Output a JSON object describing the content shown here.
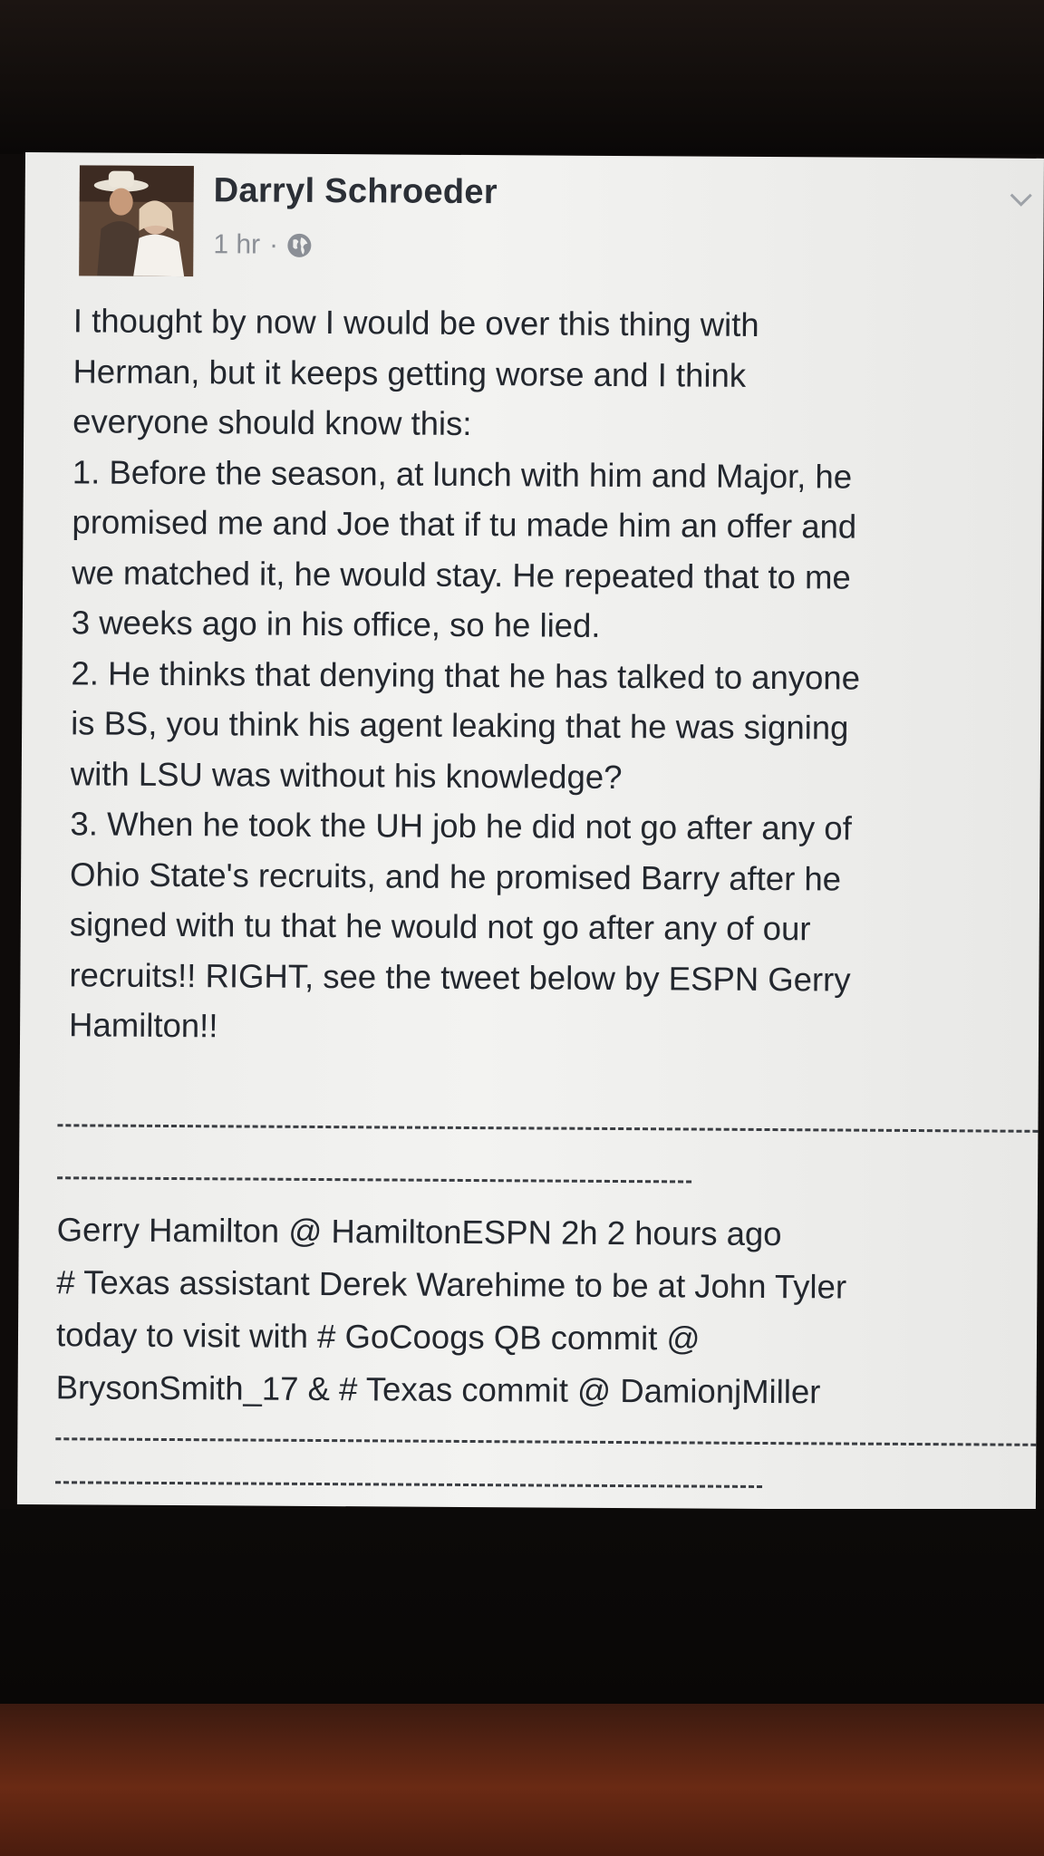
{
  "post": {
    "author": "Darryl Schroeder",
    "time": "1 hr",
    "separator": "·",
    "privacy_icon": "globe-icon",
    "menu_icon": "chevron-down-icon",
    "avatar_icon": "profile-photo",
    "body_lines": [
      "I thought by now I would be over this thing with",
      "Herman, but it keeps getting worse and I think",
      "everyone should know this:",
      "1. Before the season, at lunch with him and Major, he",
      "promised me and Joe that if tu made him an offer and",
      "we matched it, he would stay. He repeated that to me",
      "3 weeks ago in his office, so he lied.",
      "2. He thinks that denying that he has talked to anyone",
      "is BS, you think his agent leaking that he was signing",
      "with LSU was without his knowledge?",
      "3. When he took the UH job he did not go after any of",
      "Ohio State's recruits, and he promised Barry after he",
      "signed with tu that he would not go after any of our",
      "recruits!! RIGHT, see the tweet below by ESPN Gerry",
      "Hamilton!!"
    ],
    "tweet_lines": [
      "Gerry Hamilton  @ HamiltonESPN 2h 2 hours ago",
      "# Texas assistant Derek Warehime to be at John Tyler",
      "today to visit with # GoCoogs QB commit @",
      "BrysonSmith_17 & # Texas commit @ DamionjMiller"
    ]
  }
}
